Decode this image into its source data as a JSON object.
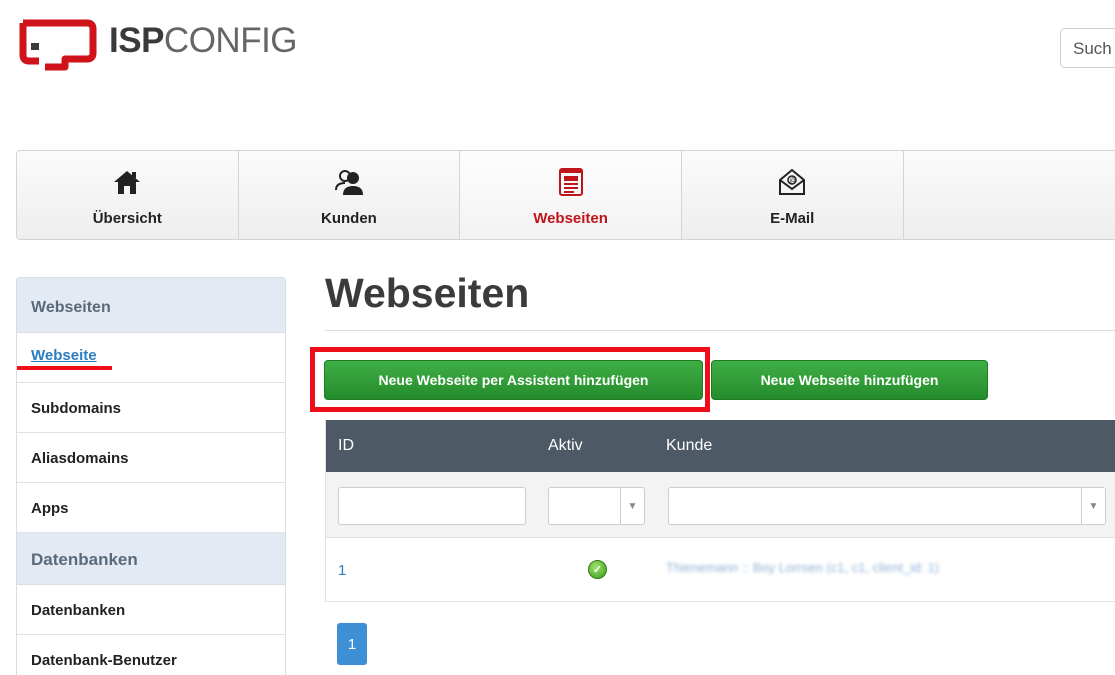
{
  "header": {
    "logo_bold": "ISP",
    "logo_rest": "CONFIG",
    "search_placeholder": "Such"
  },
  "topnav": [
    {
      "label": "Übersicht",
      "icon": "home-icon"
    },
    {
      "label": "Kunden",
      "icon": "users-icon"
    },
    {
      "label": "Webseiten",
      "icon": "webpage-icon",
      "active": true
    },
    {
      "label": "E-Mail",
      "icon": "mail-icon"
    }
  ],
  "sidebar": {
    "section1": "Webseiten",
    "items1": [
      "Webseite",
      "Subdomains",
      "Aliasdomains",
      "Apps"
    ],
    "section2": "Datenbanken",
    "items2": [
      "Datenbanken",
      "Datenbank-Benutzer"
    ]
  },
  "main": {
    "title": "Webseiten",
    "btn_wizard": "Neue Webseite per Assistent hinzufügen",
    "btn_add": "Neue Webseite hinzufügen"
  },
  "table": {
    "headers": [
      "ID",
      "Aktiv",
      "Kunde"
    ],
    "rows": [
      {
        "id": "1",
        "aktiv": true,
        "kunde": "Thienemann :: Boy Lorrsen (c1, c1, client_id: 1)"
      }
    ],
    "page": "1"
  },
  "colors": {
    "accent_red": "#c0151b",
    "button_green": "#2e9b35",
    "link_blue": "#2a7dc0",
    "highlight_red": "#ef0d1a"
  }
}
